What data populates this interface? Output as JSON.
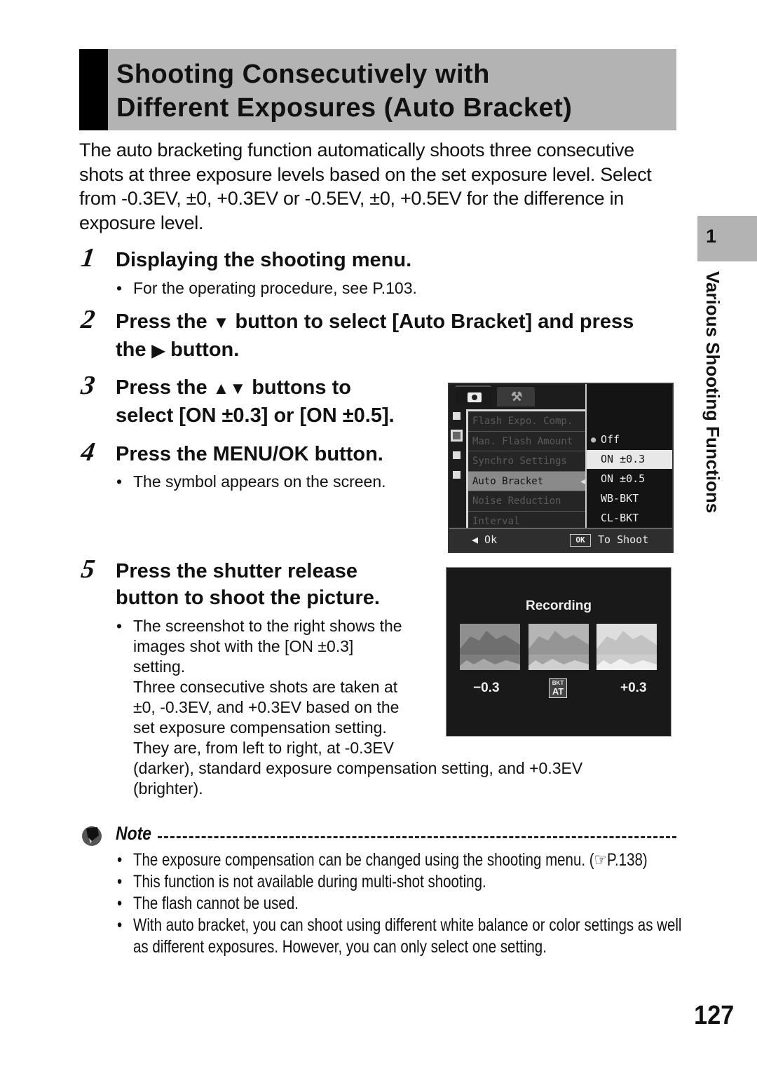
{
  "title": {
    "line1": "Shooting Consecutively with",
    "line2": "Different Exposures (Auto Bracket)"
  },
  "intro": "The auto bracketing function automatically shoots three consecutive shots at three exposure levels based on the set exposure level. Select from -0.3EV, ±0, +0.3EV or -0.5EV, ±0, +0.5EV for the difference in exposure level.",
  "steps": [
    {
      "num": "1",
      "heading": "Displaying the shooting menu.",
      "bullets": [
        "For the operating procedure, see P.103."
      ]
    },
    {
      "num": "2",
      "heading_a": "Press the",
      "icon_a": "▼",
      "heading_b": "button to select [Auto Bracket] and press",
      "heading_c": "the",
      "icon_c": "▶",
      "heading_d": "button."
    },
    {
      "num": "3",
      "heading_a": "Press the",
      "icon_a": "▲▼",
      "heading_b": "buttons to",
      "heading_c": "select [ON ±0.3] or [ON ±0.5]."
    },
    {
      "num": "4",
      "heading": "Press the MENU/OK button.",
      "bullets": [
        "The symbol appears on the screen."
      ]
    },
    {
      "num": "5",
      "heading_a": "Press the shutter release",
      "heading_b": "button to shoot the picture.",
      "bullets": [
        "The screenshot to the right shows the images shot with the [ON ±0.3] setting.",
        "Three consecutive shots are taken at ±0, -0.3EV, and +0.3EV based on the set exposure compensation setting.",
        "They are, from left to right, at -0.3EV (darker), standard exposure compensation setting, and +0.3EV (brighter)."
      ]
    }
  ],
  "step5_lines": [
    "The screenshot to the right shows the",
    "images shot with the [ON ±0.3]",
    "setting.",
    "Three consecutive shots are taken at",
    "±0, -0.3EV, and +0.3EV based on the",
    "set exposure compensation setting.",
    "They are, from left to right, at -0.3EV",
    "(darker), standard exposure compensation setting, and +0.3EV",
    "(brighter)."
  ],
  "menu_screen": {
    "tabs": [
      "camera-icon",
      "settings-icon"
    ],
    "items": [
      "Flash Expo. Comp.",
      "Man. Flash Amount",
      "Synchro Settings",
      "Auto Bracket",
      "Noise Reduction",
      "Interval"
    ],
    "selected_item": "Auto Bracket",
    "options": [
      "Off",
      "ON ±0.3",
      "ON ±0.5",
      "WB-BKT",
      "CL-BKT"
    ],
    "current_option": "Off",
    "highlighted_option": "ON ±0.3",
    "footer_back": "◀ Ok",
    "footer_ok": "OK",
    "footer_shoot": "To Shoot"
  },
  "rec_screen": {
    "title": "Recording",
    "left_value": "−0.3",
    "right_value": "+0.3",
    "bkt_top": "BKT",
    "bkt_bottom": "AT"
  },
  "chapter": {
    "num": "1",
    "label": "Various Shooting Functions"
  },
  "note": {
    "label": "Note",
    "items": [
      "The exposure compensation can be changed using the shooting menu. (☞P.138)",
      "This function is not available during multi-shot shooting.",
      "The flash cannot be used.",
      "With auto bracket, you can shoot using different white balance or color settings as well",
      "as different exposures. However, you can only select one setting."
    ]
  },
  "page_number": "127"
}
